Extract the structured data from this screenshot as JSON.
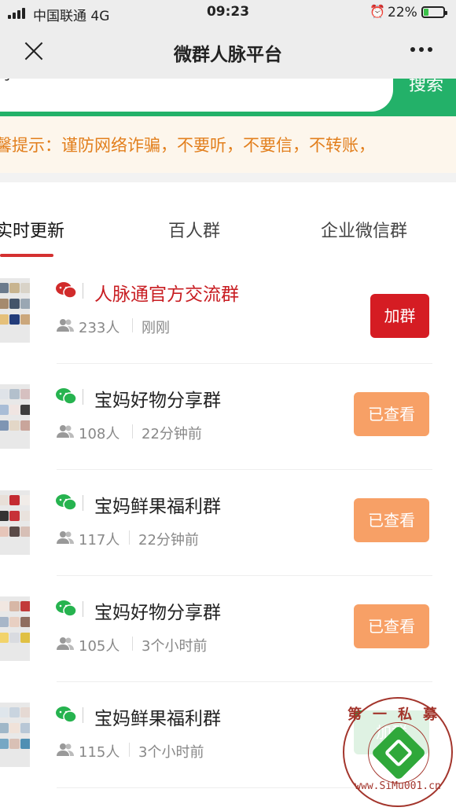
{
  "status_bar": {
    "carrier": "中国联通  4G",
    "time": "09:23",
    "battery": "22%",
    "battery_level": 0.22
  },
  "title_bar": {
    "title": "微群人脉平台"
  },
  "search": {
    "value": "宝妈",
    "button": "搜索"
  },
  "notice": {
    "text": "馨提示：谨防网络诈骗，不要听，不要信，不转账，"
  },
  "tabs": [
    {
      "label": "实时更新",
      "active": true
    },
    {
      "label": "百人群",
      "active": false
    },
    {
      "label": "企业微信群",
      "active": false
    }
  ],
  "groups": [
    {
      "name": "人脉通官方交流群",
      "count": "233人",
      "time": "刚刚",
      "button": "加群",
      "icon": "wechat-red-icon"
    },
    {
      "name": "宝妈好物分享群",
      "count": "108人",
      "time": "22分钟前",
      "button": "已查看",
      "icon": "wechat-green-icon"
    },
    {
      "name": "宝妈鲜果福利群",
      "count": "117人",
      "time": "22分钟前",
      "button": "已查看",
      "icon": "wechat-green-icon"
    },
    {
      "name": "宝妈好物分享群",
      "count": "105人",
      "time": "3个小时前",
      "button": "已查看",
      "icon": "wechat-green-icon"
    },
    {
      "name": "宝妈鲜果福利群",
      "count": "115人",
      "time": "3个小时前",
      "button": "加群",
      "icon": "wechat-green-icon"
    }
  ],
  "colors": {
    "accent_green": "#23b169",
    "join_red": "#d51c23",
    "seen_orange": "#f7a066",
    "hot_name": "#c81d22"
  },
  "watermark": {
    "top_text": "第一私募",
    "bottom_text": "www.SiMu001.cn"
  }
}
